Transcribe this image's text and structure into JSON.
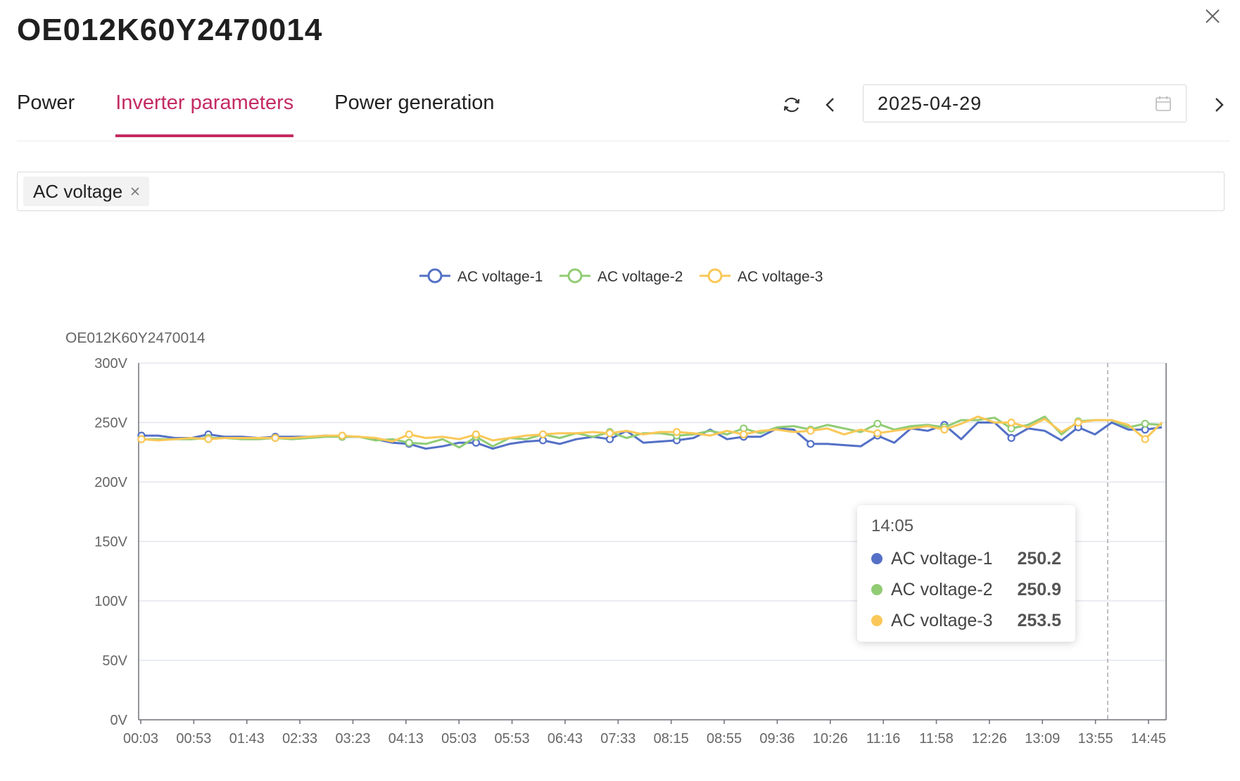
{
  "header": {
    "title": "OE012K60Y2470014"
  },
  "tabs": [
    {
      "label": "Power",
      "active": false
    },
    {
      "label": "Inverter parameters",
      "active": true
    },
    {
      "label": "Power generation",
      "active": false
    }
  ],
  "toolbar": {
    "date": "2025-04-29"
  },
  "filter": {
    "tags": [
      "AC voltage"
    ]
  },
  "colors": {
    "accent": "#c42b63",
    "series1": "#5470c6",
    "series2": "#91cc75",
    "series3": "#fac858"
  },
  "icons": [
    "close-icon",
    "refresh-icon",
    "chevron-left-icon",
    "chevron-right-icon",
    "calendar-icon",
    "tag-close-icon"
  ],
  "tooltip": {
    "time": "14:05",
    "rows": [
      {
        "name": "AC voltage-1",
        "value": "250.2",
        "color": "#5470c6"
      },
      {
        "name": "AC voltage-2",
        "value": "250.9",
        "color": "#91cc75"
      },
      {
        "name": "AC voltage-3",
        "value": "253.5",
        "color": "#fac858"
      }
    ]
  },
  "chart_data": {
    "type": "line",
    "title": "OE012K60Y2470014",
    "ylabel": "",
    "xlabel": "",
    "unit": "V",
    "ylim": [
      0,
      300
    ],
    "yticks": [
      "0V",
      "50V",
      "100V",
      "150V",
      "200V",
      "250V",
      "300V"
    ],
    "x_tick_labels": [
      "00:03",
      "00:53",
      "01:43",
      "02:33",
      "03:23",
      "04:13",
      "05:03",
      "05:53",
      "06:43",
      "07:33",
      "08:15",
      "08:55",
      "09:36",
      "10:26",
      "11:16",
      "11:58",
      "12:26",
      "13:09",
      "13:55",
      "14:45"
    ],
    "legend_position": "top-center",
    "grid": true,
    "highlight_x": "14:05",
    "series": [
      {
        "name": "AC voltage-1",
        "color": "#5470c6",
        "values": [
          239,
          239,
          237,
          237,
          240,
          238,
          238,
          237,
          238,
          238,
          238,
          239,
          238,
          238,
          236,
          233,
          232,
          228,
          230,
          233,
          233,
          228,
          232,
          234,
          235,
          232,
          236,
          238,
          236,
          243,
          233,
          234,
          235,
          237,
          244,
          236,
          238,
          238,
          245,
          244,
          232,
          232,
          231,
          230,
          239,
          233,
          245,
          243,
          248,
          236,
          250,
          250,
          237,
          245,
          243,
          235,
          246,
          240,
          250,
          244,
          244,
          246
        ]
      },
      {
        "name": "AC voltage-2",
        "color": "#91cc75",
        "values": [
          236,
          236,
          236,
          236,
          237,
          237,
          236,
          236,
          237,
          236,
          237,
          238,
          238,
          238,
          235,
          236,
          233,
          232,
          236,
          229,
          238,
          230,
          237,
          236,
          240,
          237,
          241,
          238,
          242,
          237,
          241,
          241,
          239,
          240,
          243,
          240,
          245,
          241,
          246,
          247,
          244,
          248,
          245,
          242,
          249,
          244,
          247,
          248,
          246,
          252,
          252,
          254,
          245,
          248,
          255,
          240,
          251,
          252,
          252,
          246,
          249,
          248
        ]
      },
      {
        "name": "AC voltage-3",
        "color": "#fac858",
        "values": [
          236,
          235,
          236,
          237,
          236,
          237,
          237,
          237,
          237,
          237,
          238,
          239,
          239,
          238,
          237,
          234,
          240,
          237,
          238,
          236,
          240,
          235,
          237,
          239,
          240,
          241,
          241,
          242,
          241,
          243,
          240,
          242,
          242,
          241,
          239,
          243,
          240,
          243,
          244,
          242,
          243,
          245,
          240,
          244,
          241,
          243,
          245,
          247,
          244,
          249,
          255,
          250,
          250,
          246,
          253,
          242,
          250,
          252,
          252,
          248,
          236,
          250
        ]
      }
    ]
  }
}
